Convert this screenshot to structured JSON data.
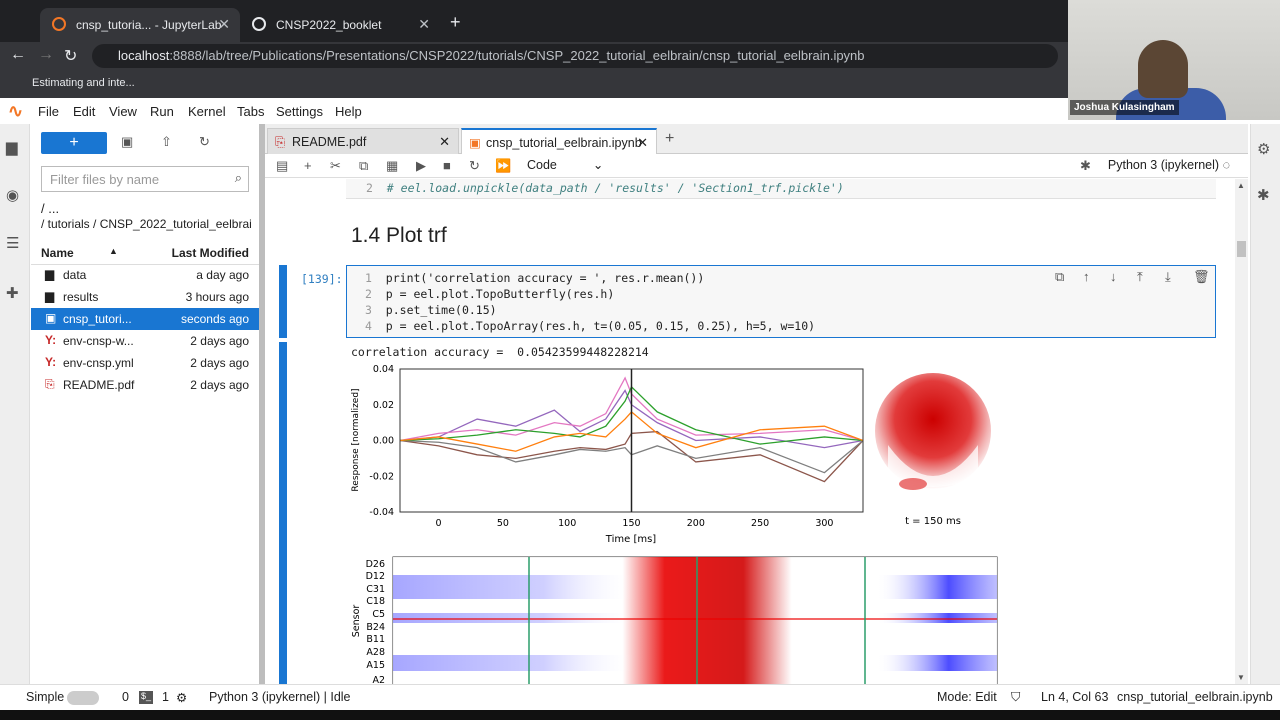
{
  "browser": {
    "tabs": [
      {
        "label": "cnsp_tutoria... - JupyterLab"
      },
      {
        "label": "CNSP2022_booklet"
      }
    ],
    "url_host": "localhost",
    "url_rest": ":8888/lab/tree/Publications/Presentations/CNSP2022/tutorials/CNSP_2022_tutorial_eelbrain/cnsp_tutorial_eelbrain.ipynb",
    "bookmark": "Estimating and inte...",
    "webcam_name": "Joshua Kulasingham"
  },
  "menu": [
    "File",
    "Edit",
    "View",
    "Run",
    "Kernel",
    "Tabs",
    "Settings",
    "Help"
  ],
  "filebrowser": {
    "filter_placeholder": "Filter files by name",
    "crumb_root": "/ ...",
    "crumb_path": "/ tutorials / CNSP_2022_tutorial_eelbrai",
    "col_name": "Name",
    "col_modified": "Last Modified",
    "files": [
      {
        "name": "data",
        "modified": "a day ago",
        "icon": "folder-icon"
      },
      {
        "name": "results",
        "modified": "3 hours ago",
        "icon": "folder-icon"
      },
      {
        "name": "cnsp_tutori...",
        "modified": "seconds ago",
        "icon": "notebook-icon"
      },
      {
        "name": "env-cnsp-w...",
        "modified": "2 days ago",
        "icon": "yaml-icon"
      },
      {
        "name": "env-cnsp.yml",
        "modified": "2 days ago",
        "icon": "yaml-icon"
      },
      {
        "name": "README.pdf",
        "modified": "2 days ago",
        "icon": "pdf-icon"
      }
    ]
  },
  "notebook": {
    "tabs": [
      {
        "label": "README.pdf"
      },
      {
        "label": "cnsp_tutorial_eelbrain.ipynb"
      }
    ],
    "cell_type": "Code",
    "kernel": "Python 3 (ipykernel)",
    "prev_line_no": "2",
    "prev_line": "# eel.load.unpickle(data_path / 'results' / 'Section1_trf.pickle')",
    "heading": "1.4 Plot trf",
    "prompt": "[139]:",
    "code": [
      {
        "no": "1",
        "text": "print('correlation accuracy = ', res.r.mean())"
      },
      {
        "no": "2",
        "text": "p = eel.plot.TopoButterfly(res.h)"
      },
      {
        "no": "3",
        "text": "p.set_time(0.15)"
      },
      {
        "no": "4",
        "text": "p = eel.plot.TopoArray(res.h, t=(0.05, 0.15, 0.25), h=5, w=10)"
      }
    ],
    "output_text": "correlation accuracy =  0.05423599448228214",
    "topo_time": "t = 150 ms",
    "sensor_axis_label": "Sensor",
    "sensors": [
      "D26",
      "D12",
      "C31",
      "C18",
      "C5",
      "B24",
      "B11",
      "A28",
      "A15",
      "A2"
    ]
  },
  "chart_data": {
    "type": "line",
    "title": "",
    "xlabel": "Time [ms]",
    "ylabel": "Response [normalized]",
    "xlim": [
      -30,
      330
    ],
    "ylim": [
      -0.04,
      0.04
    ],
    "xticks": [
      0,
      50,
      100,
      150,
      200,
      250,
      300
    ],
    "yticks": [
      -0.04,
      -0.02,
      0.0,
      0.02,
      0.04
    ],
    "ytick_labels": [
      "-0.04",
      "-0.02",
      "0.00",
      "0.02",
      "0.04"
    ],
    "time_marker": 150,
    "series": [
      {
        "x": [
          -30,
          0,
          30,
          60,
          90,
          110,
          130,
          145,
          150,
          170,
          200,
          250,
          300,
          330
        ],
        "values": [
          0,
          0.002,
          0.012,
          0.008,
          0.017,
          0.005,
          0.012,
          0.028,
          0.02,
          0.01,
          0,
          0.002,
          -0.004,
          0
        ]
      },
      {
        "x": [
          -30,
          0,
          30,
          60,
          90,
          110,
          130,
          145,
          150,
          170,
          200,
          250,
          300,
          330
        ],
        "values": [
          0,
          -0.003,
          -0.008,
          -0.01,
          -0.006,
          -0.004,
          -0.005,
          -0.002,
          0.004,
          0.005,
          -0.012,
          -0.008,
          -0.023,
          0
        ]
      },
      {
        "x": [
          -30,
          0,
          30,
          60,
          90,
          110,
          130,
          145,
          150,
          170,
          200,
          250,
          300,
          330
        ],
        "values": [
          0,
          0.004,
          0.006,
          0.003,
          0.01,
          0.008,
          0.015,
          0.035,
          0.026,
          0.012,
          0.003,
          0.004,
          0.006,
          0
        ]
      },
      {
        "x": [
          -30,
          0,
          30,
          60,
          90,
          110,
          130,
          145,
          150,
          170,
          200,
          250,
          300,
          330
        ],
        "values": [
          0,
          -0.001,
          -0.004,
          -0.012,
          -0.008,
          -0.005,
          -0.006,
          -0.004,
          -0.008,
          -0.003,
          -0.01,
          -0.004,
          -0.018,
          0
        ]
      },
      {
        "x": [
          -30,
          0,
          30,
          60,
          90,
          110,
          130,
          145,
          150,
          170,
          200,
          250,
          300,
          330
        ],
        "values": [
          0,
          0.001,
          0.003,
          0.006,
          0.004,
          0.002,
          0.008,
          0.022,
          0.03,
          0.016,
          0.006,
          -0.002,
          0.002,
          0
        ]
      },
      {
        "x": [
          -30,
          0,
          30,
          60,
          90,
          110,
          130,
          145,
          150,
          170,
          200,
          250,
          300,
          330
        ],
        "values": [
          0,
          0.002,
          -0.002,
          -0.006,
          0.002,
          0.004,
          0.002,
          0.012,
          0.016,
          0.004,
          -0.004,
          0.006,
          0.008,
          0
        ]
      }
    ]
  },
  "colors": {
    "accent": "#1976d2",
    "series": [
      "#9467bd",
      "#8c564b",
      "#e377c2",
      "#7f7f7f",
      "#2ca02c",
      "#ff7f0e"
    ]
  },
  "status": {
    "mode_label": "Simple",
    "count1": "0",
    "count2": "1",
    "kernel_status": "Python 3 (ipykernel) | Idle",
    "mode": "Mode: Edit",
    "cursor": "Ln 4, Col 63",
    "file": "cnsp_tutorial_eelbrain.ipynb"
  }
}
